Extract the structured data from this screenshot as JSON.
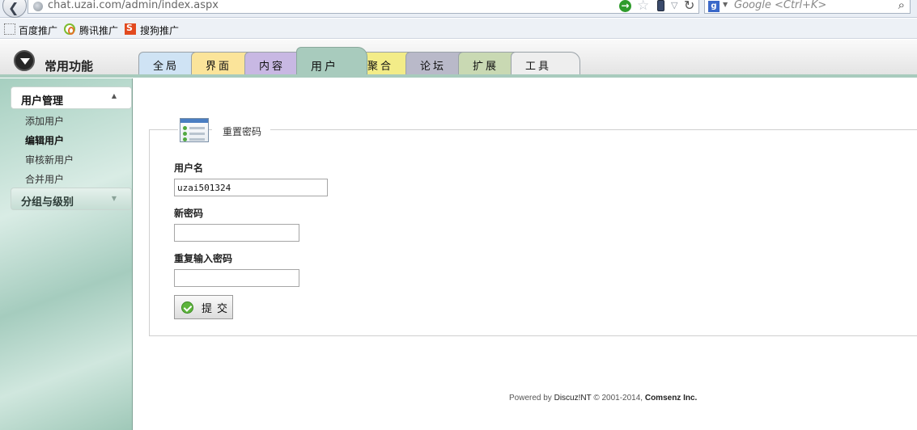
{
  "browser": {
    "url": "chat.uzai.com/admin/index.aspx",
    "search_placeholder": "Google <Ctrl+K>",
    "icons": [
      "back-icon",
      "globe-icon",
      "go-icon",
      "star-icon",
      "phone-icon",
      "dropdown-icon",
      "reload-icon",
      "google-icon",
      "search-icon"
    ]
  },
  "bookmarks": [
    {
      "label": "百度推广",
      "icon": "dotted-page-icon"
    },
    {
      "label": "腾讯推广",
      "icon": "tencent-icon"
    },
    {
      "label": "搜狗推广",
      "icon": "sogou-icon"
    }
  ],
  "header": {
    "title": "常用功能",
    "tabs": [
      {
        "label": "全局",
        "color": "#cfe3f4",
        "active": false
      },
      {
        "label": "界面",
        "color": "#fbe49a",
        "active": false
      },
      {
        "label": "内容",
        "color": "#c8b8e3",
        "active": false
      },
      {
        "label": "用户",
        "color": "#a8cbbd",
        "active": true
      },
      {
        "label": "聚合",
        "color": "#f3ec88",
        "active": false
      },
      {
        "label": "论坛",
        "color": "#b9b9c9",
        "active": false
      },
      {
        "label": "扩展",
        "color": "#c9d9b3",
        "active": false
      },
      {
        "label": "工具",
        "color": "#eeeeee",
        "active": false
      }
    ]
  },
  "sidebar": {
    "sections": [
      {
        "title": "用户管理",
        "expanded": true,
        "items": [
          {
            "label": "添加用户",
            "current": false
          },
          {
            "label": "编辑用户",
            "current": true
          },
          {
            "label": "审核新用户",
            "current": false
          },
          {
            "label": "合并用户",
            "current": false
          }
        ]
      },
      {
        "title": "分组与级别",
        "expanded": false,
        "items": []
      }
    ]
  },
  "form": {
    "legend": "重置密码",
    "username_label": "用户名",
    "username_value": "uzai501324",
    "new_password_label": "新密码",
    "new_password_value": "",
    "repeat_password_label": "重复输入密码",
    "repeat_password_value": "",
    "submit_label": "提交"
  },
  "footer": {
    "prefix": "Powered by",
    "brand": "Discuz!NT",
    "copyright": "© 2001-2014,",
    "company": "Comsenz Inc."
  }
}
